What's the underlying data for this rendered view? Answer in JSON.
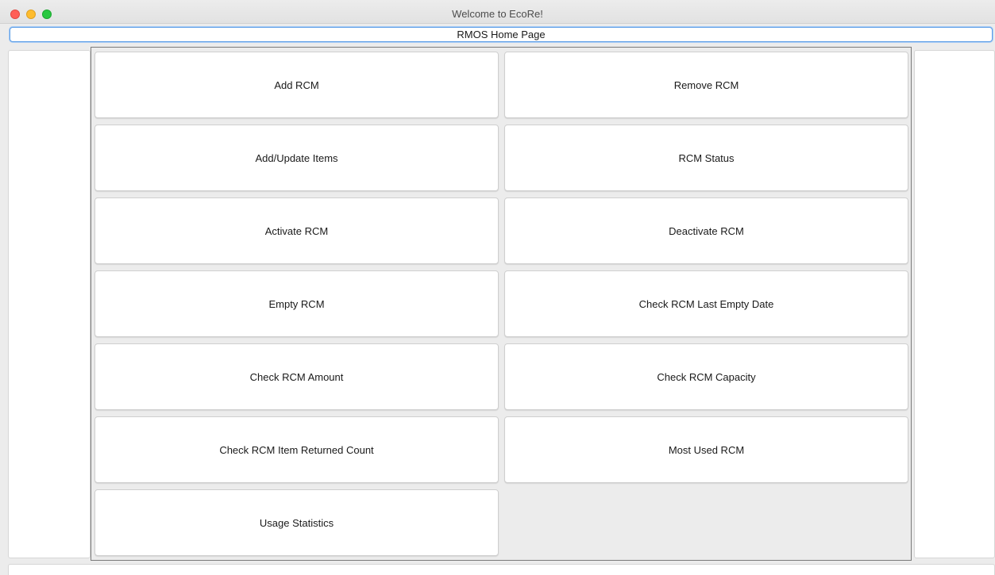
{
  "window": {
    "title": "Welcome to EcoRe!"
  },
  "header": {
    "label": "RMOS Home Page"
  },
  "buttons": {
    "add_rcm": "Add RCM",
    "remove_rcm": "Remove RCM",
    "add_update_items": "Add/Update Items",
    "rcm_status": "RCM Status",
    "activate_rcm": "Activate RCM",
    "deactivate_rcm": "Deactivate RCM",
    "empty_rcm": "Empty RCM",
    "check_last_empty_date": "Check RCM Last Empty Date",
    "check_rcm_amount": "Check RCM Amount",
    "check_rcm_capacity": "Check RCM Capacity",
    "check_item_returned_count": "Check RCM Item Returned Count",
    "most_used_rcm": "Most Used RCM",
    "usage_statistics": "Usage Statistics"
  },
  "colors": {
    "close": "#ff5f57",
    "minimize": "#febc2e",
    "maximize": "#28c840",
    "focus_ring": "#5e9ee6"
  }
}
